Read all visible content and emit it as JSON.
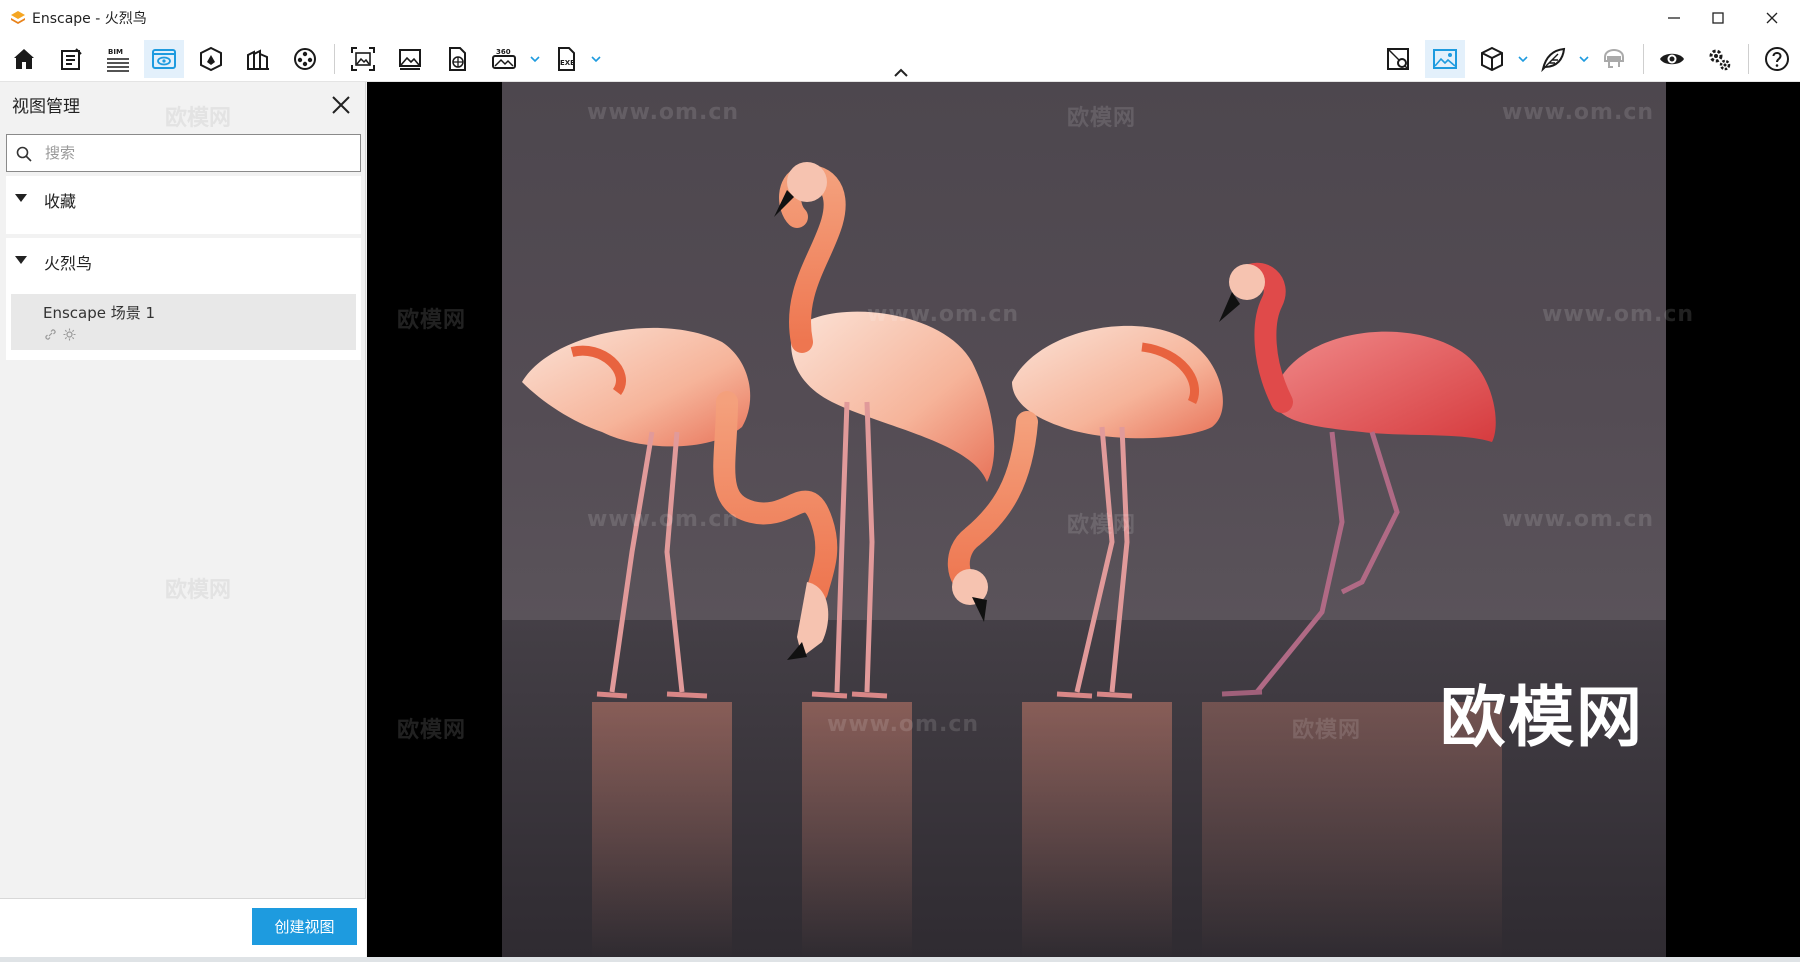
{
  "window": {
    "title": "Enscape - 火烈鸟",
    "controls": [
      "minimize-icon",
      "maximize-icon",
      "close-icon"
    ]
  },
  "toolbar": {
    "left_tools": [
      {
        "name": "home-icon",
        "label": ""
      },
      {
        "name": "notes-icon",
        "label": ""
      },
      {
        "name": "bim-icon",
        "label": "BIM"
      },
      {
        "name": "views-icon",
        "label": "",
        "active": true
      },
      {
        "name": "materials-icon",
        "label": ""
      },
      {
        "name": "asset-library-icon",
        "label": ""
      },
      {
        "name": "video-editor-icon",
        "label": ""
      },
      {
        "name": "screenshot-icon",
        "label": ""
      },
      {
        "name": "batch-render-icon",
        "label": ""
      },
      {
        "name": "web-export-icon",
        "label": ""
      },
      {
        "name": "panorama-icon",
        "label": "360"
      },
      {
        "name": "exe-export-icon",
        "label": "EXE"
      }
    ],
    "right_tools": [
      "map-pin-icon",
      "image-settings-icon",
      "cube-icon",
      "leaf-icon",
      "vr-headset-icon",
      "eye-icon",
      "settings-icon",
      "help-icon"
    ],
    "accent_color": "#1e9bdf"
  },
  "panel": {
    "title": "视图管理",
    "search_placeholder": "搜索",
    "groups": [
      {
        "label": "收藏",
        "expanded": true,
        "items": []
      },
      {
        "label": "火烈鸟",
        "expanded": true,
        "items": [
          {
            "label": "Enscape 场景 1",
            "icons": [
              "link-icon",
              "sun-icon"
            ]
          }
        ]
      }
    ],
    "create_button": "创建视图"
  },
  "viewport": {
    "big_watermark": "欧模网",
    "watermarks": [
      "www.om.cn",
      "欧模网"
    ]
  }
}
